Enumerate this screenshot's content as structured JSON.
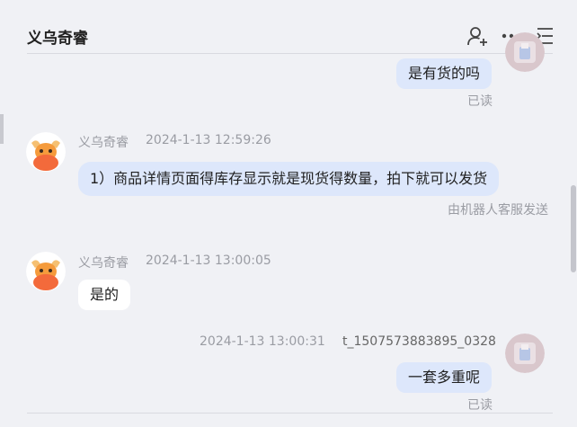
{
  "header": {
    "title": "义乌奇睿",
    "icons": [
      "add-user-icon",
      "more-icon",
      "menu-icon"
    ]
  },
  "messages": [
    {
      "side": "right",
      "text": "是有货的吗",
      "status": "已读"
    },
    {
      "side": "left",
      "sender": "义乌奇睿",
      "time": "2024-1-13 12:59:26",
      "text": "1）商品详情页面得库存显示就是现货得数量，拍下就可以发货",
      "note": "由机器人客服发送"
    },
    {
      "side": "left",
      "sender": "义乌奇睿",
      "time": "2024-1-13 13:00:05",
      "text": "是的"
    },
    {
      "side": "right",
      "sender": "t_1507573883895_0328",
      "time": "2024-1-13 13:00:31",
      "text": "一套多重呢",
      "status": "已读"
    }
  ],
  "colors": {
    "background": "#f0f1f5",
    "bubble": "#dde7fb",
    "meta_text": "#9a9ca3"
  }
}
